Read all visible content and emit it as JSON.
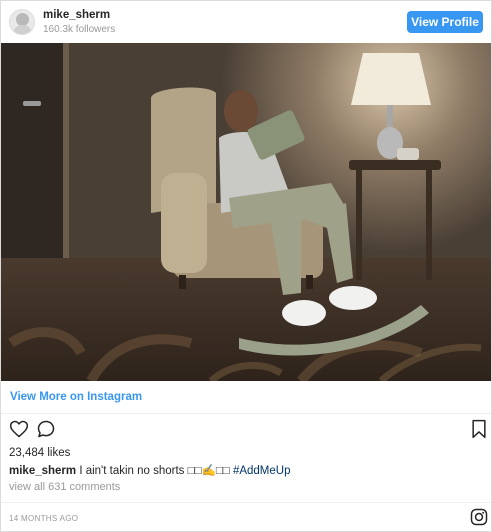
{
  "header": {
    "username": "mike_sherm",
    "followers": "160.3k followers",
    "view_profile_label": "View Profile"
  },
  "photo": {
    "icon": "photo-image"
  },
  "footer": {
    "view_more_label": "View More on Instagram",
    "likes": "23,484 likes",
    "caption_user": "mike_sherm",
    "caption_text": " I ain't takin no shorts □□✍️□□ ",
    "hashtag": "#AddMeUp",
    "comments_link": "view all 631 comments",
    "timestamp": "14 MONTHS AGO"
  },
  "icons": {
    "like": "heart-icon",
    "comment": "comment-icon",
    "save": "bookmark-icon",
    "brand": "instagram-logo-icon"
  },
  "colors": {
    "accent": "#3897f0",
    "hashtag": "#003569",
    "muted": "#999999"
  }
}
